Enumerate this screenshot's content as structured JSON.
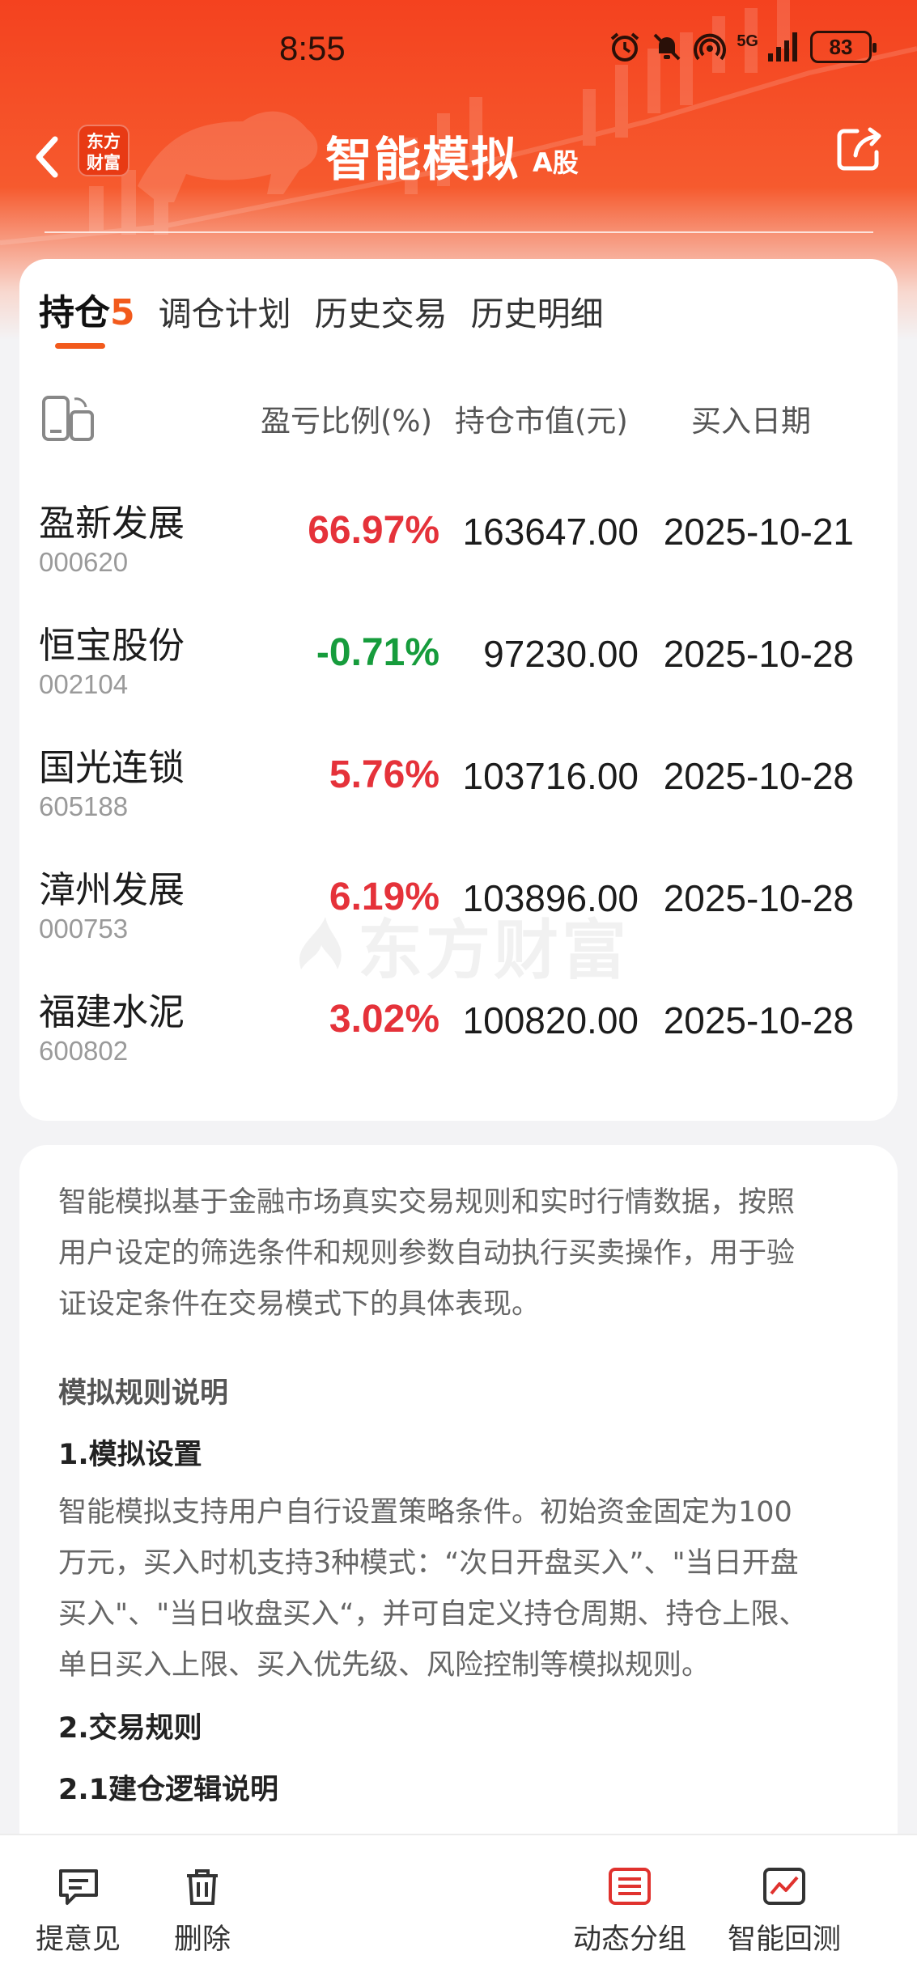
{
  "status_bar": {
    "time": "8:55",
    "network": "5G",
    "battery": "83"
  },
  "nav": {
    "logo_line1": "东方",
    "logo_line2": "财富",
    "title": "智能模拟",
    "subtitle": "A股"
  },
  "tabs": [
    {
      "label": "持仓",
      "count": "5",
      "active": true
    },
    {
      "label": "调仓计划"
    },
    {
      "label": "历史交易"
    },
    {
      "label": "历史明细"
    }
  ],
  "columns": {
    "pct": "盈亏比例(%)",
    "market_value": "持仓市值(元)",
    "buy_date": "买入日期"
  },
  "holdings": [
    {
      "name": "盈新发展",
      "code": "000620",
      "pct": "66.97%",
      "market_value": "163647.00",
      "buy_date": "2025-10-21",
      "direction": "up"
    },
    {
      "name": "恒宝股份",
      "code": "002104",
      "pct": "-0.71%",
      "market_value": "97230.00",
      "buy_date": "2025-10-28",
      "direction": "down"
    },
    {
      "name": "国光连锁",
      "code": "605188",
      "pct": "5.76%",
      "market_value": "103716.00",
      "buy_date": "2025-10-28",
      "direction": "up"
    },
    {
      "name": "漳州发展",
      "code": "000753",
      "pct": "6.19%",
      "market_value": "103896.00",
      "buy_date": "2025-10-28",
      "direction": "up"
    },
    {
      "name": "福建水泥",
      "code": "600802",
      "pct": "3.02%",
      "market_value": "100820.00",
      "buy_date": "2025-10-28",
      "direction": "up"
    }
  ],
  "watermark": "东方财富",
  "description": {
    "intro_lines": [
      "智能模拟基于金融市场真实交易规则和实时行情数据，按照",
      "用户设定的筛选条件和规则参数自动执行买卖操作，用于验",
      "证设定条件在交易模式下的具体表现。"
    ],
    "rules_heading": "模拟规则说明",
    "section1_heading": "1.模拟设置",
    "section1_lines": [
      "智能模拟支持用户自行设置策略条件。初始资金固定为100",
      "万元，买入时机支持3种模式：“次日开盘买入”、\"当日开盘",
      "买入\"、\"当日收盘买入“，并可自定义持仓周期、持仓上限、",
      "单日买入上限、买入优先级、风险控制等模拟规则。"
    ],
    "section2_heading": "2.交易规则",
    "section21_heading": "2.1建仓逻辑说明"
  },
  "bottom_bar": {
    "feedback": "提意见",
    "delete": "删除",
    "dynamic_group": "动态分组",
    "backtest": "智能回测"
  },
  "colors": {
    "brand": "#f4421f",
    "accent": "#f25a1c",
    "up": "#e5323a",
    "down": "#169c3c"
  }
}
